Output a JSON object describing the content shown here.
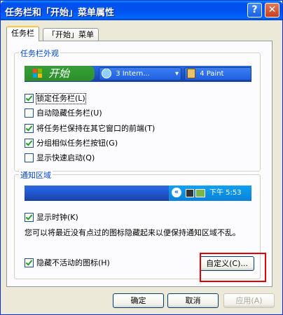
{
  "window": {
    "title": "任务栏和「开始」菜单属性",
    "help_glyph": "?",
    "close_glyph": "✕"
  },
  "tabs": [
    {
      "label": "任务栏",
      "active": true
    },
    {
      "label": "「开始」菜单",
      "active": false
    }
  ],
  "taskbar_group": {
    "legend": "任务栏外观",
    "preview": {
      "start_label": "开始",
      "task1": "3 Intern...",
      "task2": "4 Paint"
    },
    "options": [
      {
        "label": "锁定任务栏(L)",
        "checked": true
      },
      {
        "label": "自动隐藏任务栏(U)",
        "checked": false
      },
      {
        "label": "将任务栏保持在其它窗口的前端(T)",
        "checked": true
      },
      {
        "label": "分组相似任务栏按钮(G)",
        "checked": true
      },
      {
        "label": "显示快速启动(Q)",
        "checked": false
      }
    ]
  },
  "notify_group": {
    "legend": "通知区域",
    "tray_time": "下午 5:53",
    "show_clock": {
      "label": "显示时钟(K)",
      "checked": true
    },
    "description": "您可以将最近没有点过的图标隐藏起来以便保持通知区域不乱。",
    "hide_inactive": {
      "label": "隐藏不活动的图标(H)",
      "checked": true
    },
    "customize_button": "自定义(C)..."
  },
  "footer": {
    "ok": "确定",
    "cancel": "取消",
    "apply": "应用(A)"
  },
  "colors": {
    "highlight": "#e00000",
    "legend": "#0046d5"
  }
}
